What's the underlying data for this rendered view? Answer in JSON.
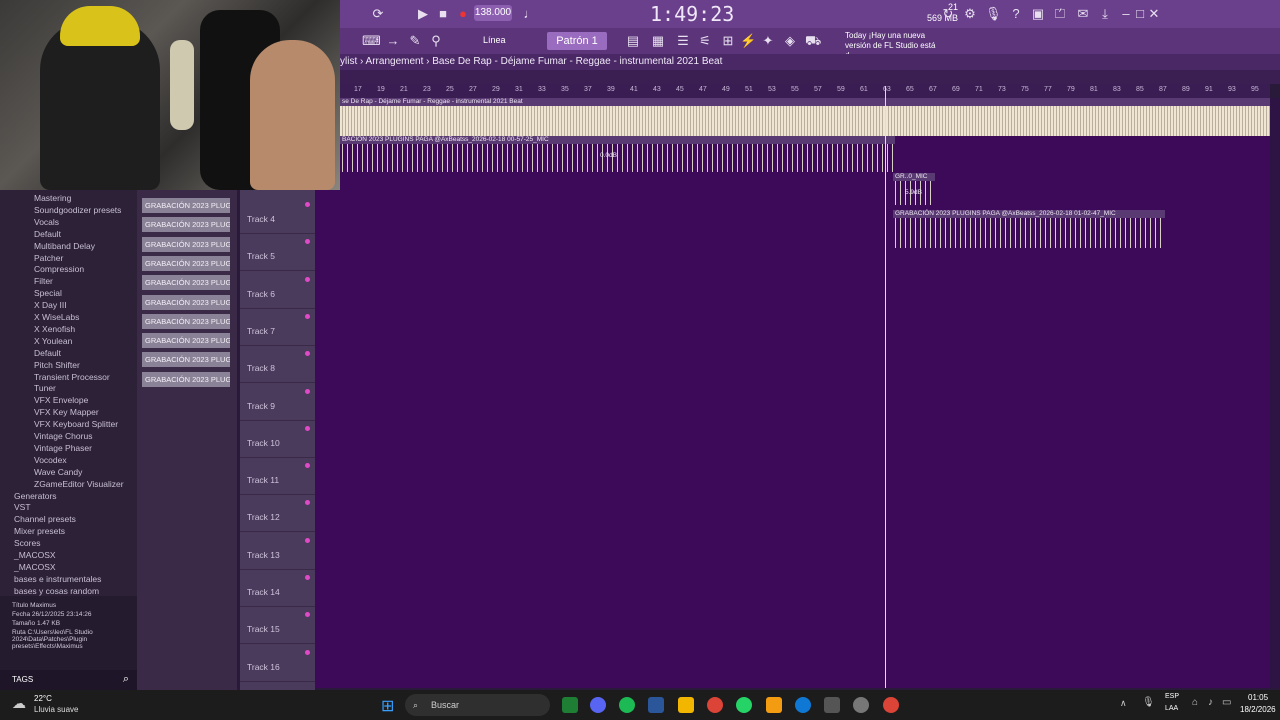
{
  "toolbar": {
    "tempo": "138.000",
    "time": "1:49:23",
    "memory_mb": "569 MB",
    "cpu": "21",
    "mode": "Línea",
    "pattern": "Patrón 1",
    "hint_title": "Today ¡Hay una nueva",
    "hint_body": "versión de FL Studio está d..."
  },
  "playlist": {
    "breadcrumb": "ylist › Arrangement › Base De Rap - Déjame Fumar - Reggae - instrumental 2021  Beat",
    "clip1": "se De Rap - Déjame Fumar - Reggae - instrumental 2021  Beat",
    "clip2": "BACIÓN 2023 PLUGINS PAGA @AxBeatss_2026-02-18 00-57-25_MIC",
    "clip2_gain": "0.0dB",
    "clip3": "GR..0_MIC",
    "clip3_gain": "5.9dB",
    "clip4": "GRABACIÓN 2023 PLUGINS PAGA @AxBeatss_2026-02-18 01-02-47_MIC"
  },
  "ruler": [
    "17",
    "19",
    "21",
    "23",
    "25",
    "27",
    "29",
    "31",
    "33",
    "35",
    "37",
    "39",
    "41",
    "43",
    "45",
    "47",
    "49",
    "51",
    "53",
    "55",
    "57",
    "59",
    "61",
    "63",
    "65",
    "67",
    "69",
    "71",
    "73",
    "75",
    "77",
    "79",
    "81",
    "83",
    "85",
    "87",
    "89",
    "91",
    "93",
    "95"
  ],
  "browser": {
    "items": [
      "Mastering",
      "Soundgoodizer presets",
      "Vocals",
      "Default",
      "Multiband Delay",
      "Patcher",
      "Compression",
      "Filter",
      "Special",
      "X Day III",
      "X WiseLabs",
      "X Xenofish",
      "X Youlean",
      "Default",
      "Pitch Shifter",
      "Transient Processor",
      "Tuner",
      "VFX Envelope",
      "VFX Key Mapper",
      "VFX Keyboard Splitter",
      "Vintage Chorus",
      "Vintage Phaser",
      "Vocodex",
      "Wave Candy",
      "ZGameEditor Visualizer",
      "Generators",
      "VST",
      "Channel presets",
      "Mixer presets",
      "Scores",
      "_MACOSX",
      "_MACOSX",
      "bases e instrumentales",
      "bases y cosas random"
    ]
  },
  "file_info": {
    "title_label": "Título",
    "title_value": "Maximus",
    "date_label": "Fecha",
    "date_value": "26/12/2025 23:14:26",
    "size_label": "Tamaño",
    "size_value": "1.47 KB",
    "path_label": "Ruta",
    "path_value": "C:\\Users\\leo\\FL Studio 2024\\Data\\Patches\\Plugin presets\\Effects\\Maximus"
  },
  "tags_label": "TAGS",
  "clips_list": [
    "GRABACIÓN 2023 PLUGINS...",
    "GRABACIÓN 2023 PLUGINS...",
    "GRABACIÓN 2023 PLUGINS...",
    "GRABACIÓN 2023 PLUGINS...",
    "GRABACIÓN 2023 PLUGINS...",
    "GRABACIÓN 2023 PLUGINS...",
    "GRABACIÓN 2023 PLUGINS...",
    "GRABACIÓN 2023 PLUGINS...",
    "GRABACIÓN 2023 PLUGINS...",
    "GRABACIÓN 2023 PLUGINS..."
  ],
  "tracks": [
    "Track 4",
    "Track 5",
    "Track 6",
    "Track 7",
    "Track 8",
    "Track 9",
    "Track 10",
    "Track 11",
    "Track 12",
    "Track 13",
    "Track 14",
    "Track 15",
    "Track 16"
  ],
  "taskbar": {
    "weather_temp": "22°C",
    "weather_desc": "Lluvia suave",
    "search": "Buscar",
    "lang1": "ESP",
    "lang2": "LAA",
    "clock": "01:05",
    "date": "18/2/2026"
  },
  "colors": {
    "accent": "#6a3f8c",
    "grid": "#3d0a5a",
    "waveform": "#efe5d2"
  }
}
